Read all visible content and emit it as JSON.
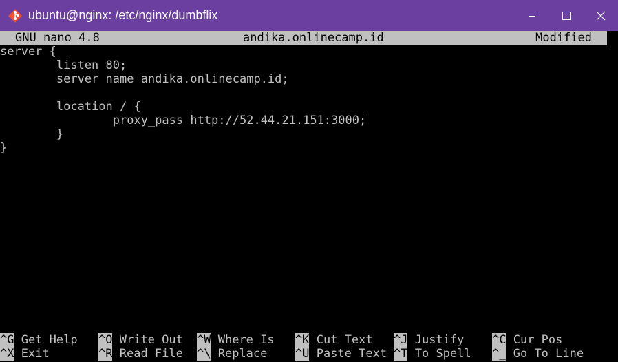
{
  "window": {
    "title": "ubuntu@nginx: /etc/nginx/dumbflix",
    "title_bar_color": "#6b3fa0",
    "app_icon": "git-bash-diamond-icon",
    "controls": [
      "minimize-icon",
      "maximize-icon",
      "close-icon"
    ]
  },
  "nano": {
    "version": "GNU nano 4.8",
    "filename": "andika.onlinecamp.id",
    "status": "Modified"
  },
  "editor": {
    "lines": [
      "server {",
      "        listen 80;",
      "        server name andika.onlinecamp.id;",
      "",
      "        location / {",
      "                proxy_pass http://52.44.21.151:3000;",
      "        }",
      "}"
    ]
  },
  "shortcuts": [
    {
      "key": "^G",
      "label": "Get Help"
    },
    {
      "key": "^O",
      "label": "Write Out"
    },
    {
      "key": "^W",
      "label": "Where Is"
    },
    {
      "key": "^K",
      "label": "Cut Text"
    },
    {
      "key": "^J",
      "label": "Justify"
    },
    {
      "key": "^C",
      "label": "Cur Pos"
    },
    {
      "key": "^X",
      "label": "Exit"
    },
    {
      "key": "^R",
      "label": "Read File"
    },
    {
      "key": "^\\",
      "label": "Replace"
    },
    {
      "key": "^U",
      "label": "Paste Text"
    },
    {
      "key": "^T",
      "label": "To Spell"
    },
    {
      "key": "^_",
      "label": "Go To Line"
    }
  ]
}
